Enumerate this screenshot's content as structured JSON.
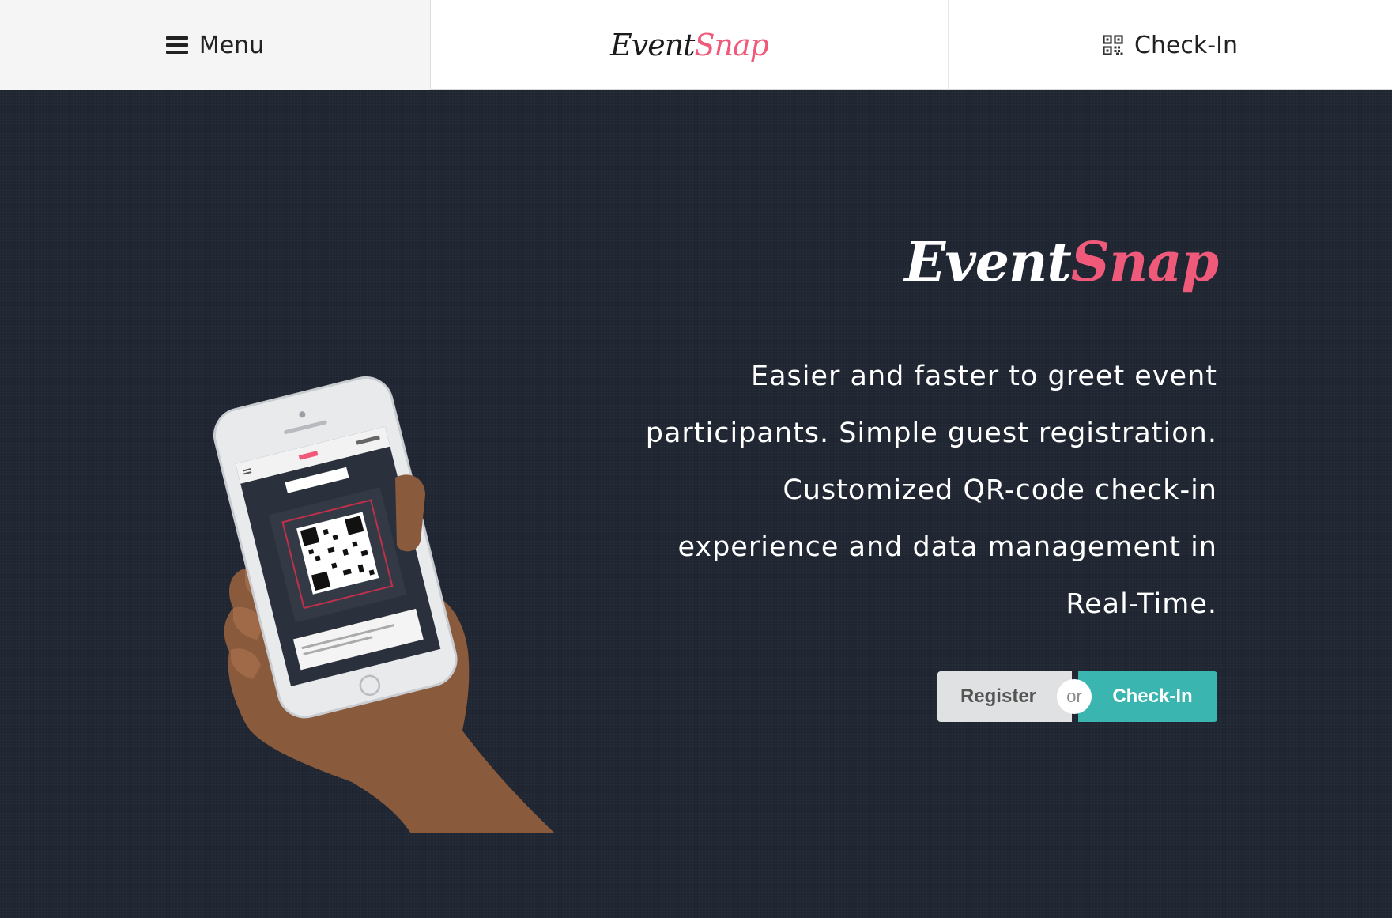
{
  "header": {
    "menu_label": "Menu",
    "menu_icon": "hamburger-icon",
    "logo_event": "Event",
    "logo_snap": "Snap",
    "checkin_label": "Check-In",
    "checkin_icon": "qr-code-icon"
  },
  "hero": {
    "logo_event": "Event",
    "logo_snap": "Snap",
    "tagline": "Easier and faster to greet event participants. Simple guest registration. Customized QR-code check-in experience and data management in Real-Time.",
    "register_label": "Register",
    "or_label": "or",
    "checkin_label": "Check-In"
  },
  "colors": {
    "background": "#1f2631",
    "accent_pink": "#f05a7a",
    "checkin_teal": "#3ab5b0",
    "register_gray": "#e0e1e2"
  }
}
